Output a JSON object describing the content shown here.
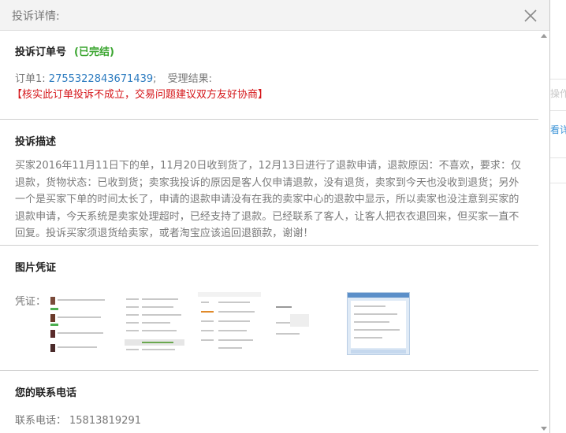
{
  "dialog": {
    "title": "投诉详情:"
  },
  "order_section": {
    "title": "投诉订单号",
    "status": "(已完结)",
    "order_label": "订单1:",
    "order_number": "2755322843671439",
    "separator": ";",
    "result_label": "受理结果:",
    "notice": "【核实此订单投诉不成立，交易问题建议双方友好协商】"
  },
  "description_section": {
    "title": "投诉描述",
    "text": "买家2016年11月11日下的单，11月20日收到货了，12月13日进行了退款申请，退款原因：不喜欢，要求：仅退款，货物状态：已收到货；卖家我投诉的原因是客人仅申请退款，没有退货，卖家到今天也没收到退货；另外一个是买家下单的时间太长了，申请的退款申请没有在我的卖家中心的退款中显示，所以卖家也没注意到买家的退款申请，今天系统是卖家处理超时，已经支持了退款。已经联系了客人，让客人把衣衣退回来，但买家一直不回复。投诉买家须退货给卖家，或者淘宝应该追回退额款，谢谢！"
  },
  "evidence_section": {
    "title": "图片凭证",
    "label": "凭证：",
    "thumbnails": [
      "thumbnail-1",
      "thumbnail-2",
      "thumbnail-3",
      "thumbnail-4",
      "thumbnail-5"
    ]
  },
  "contact_section": {
    "title": "您的联系电话",
    "label": "联系电话：",
    "phone": "15813819291"
  },
  "background": {
    "text_1": "操作",
    "text_2": "看详"
  },
  "colors": {
    "link": "#2d7cc0",
    "status_green": "#3aa52f",
    "notice_red": "#d5161a"
  },
  "icons": [
    "close-icon",
    "scroll-up-arrow-icon",
    "scroll-down-arrow-icon"
  ]
}
